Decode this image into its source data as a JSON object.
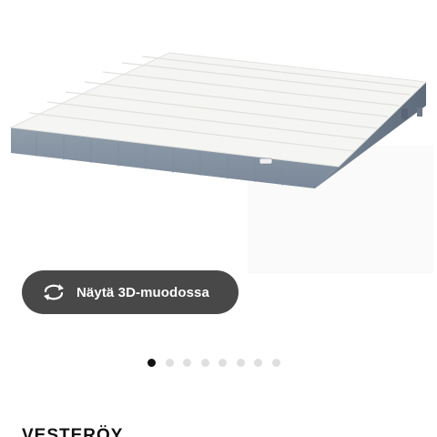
{
  "gallery": {
    "image": {
      "subject": "mattress",
      "colors": {
        "top": "#f4f4f2",
        "side": "#8593a3",
        "side_dark": "#6f7d8e"
      }
    },
    "view_3d_button": {
      "label": "Näytä 3D-muodossa",
      "icon": "rotate-3d-icon",
      "background": "#484848",
      "text_color": "#ffffff"
    },
    "pagination": {
      "total": 8,
      "active_index": 0,
      "active_color": "#111111",
      "inactive_color": "#dfdfdf"
    }
  },
  "product": {
    "name": "VESTERÖY"
  }
}
